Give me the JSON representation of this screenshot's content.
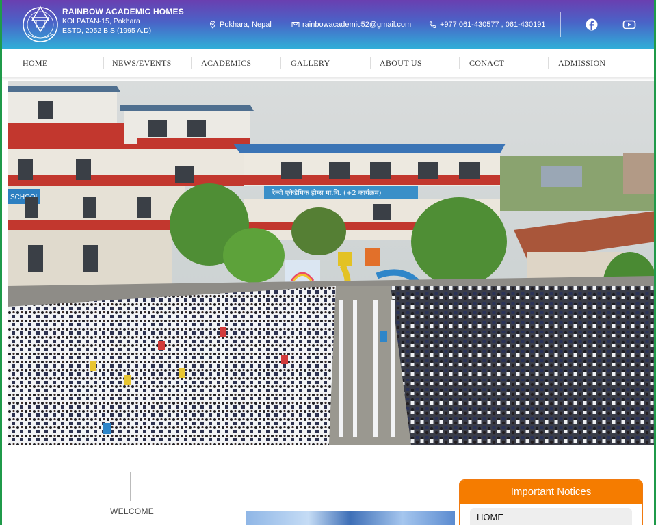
{
  "header": {
    "school_name": "RAINBOW ACADEMIC HOMES",
    "address_line": "KOLPATAN-15, Pokhara",
    "established_line": "ESTD, 2052 B.S (1995 A.D)",
    "location": "Pokhara, Nepal",
    "email": "rainbowacademic52@gmail.com",
    "phone": "+977 061-430577 , 061-430191"
  },
  "nav": {
    "items": [
      "HOME",
      "NEWS/EVENTS",
      "ACADEMICS",
      "GALLERY",
      "ABOUT US",
      "CONACT",
      "ADMISSION"
    ]
  },
  "hero": {
    "building_sign": "रेन्बो एकेडेमिक होम्स मा.वि. (+2 कार्यक्रम)",
    "school_board": "SCHOOL"
  },
  "welcome": {
    "label": "WELCOME"
  },
  "notices": {
    "title": "Important Notices",
    "first_item": "HOME"
  },
  "colors": {
    "accent": "#f57c00",
    "frame": "#1f9a4a",
    "header_top": "#6a3fb0",
    "header_bottom": "#2fb0d8"
  }
}
